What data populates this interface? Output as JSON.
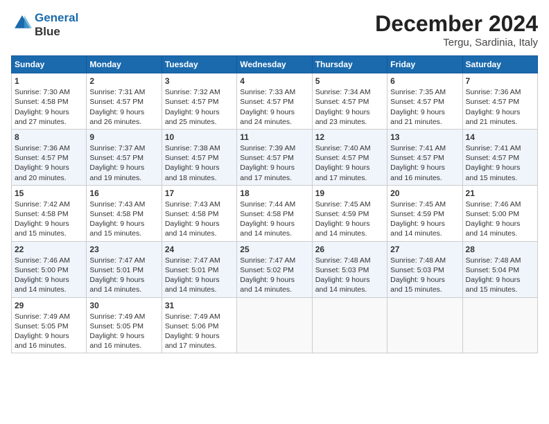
{
  "header": {
    "logo_line1": "General",
    "logo_line2": "Blue",
    "month": "December 2024",
    "location": "Tergu, Sardinia, Italy"
  },
  "days_of_week": [
    "Sunday",
    "Monday",
    "Tuesday",
    "Wednesday",
    "Thursday",
    "Friday",
    "Saturday"
  ],
  "weeks": [
    [
      {
        "day": "1",
        "lines": [
          "Sunrise: 7:30 AM",
          "Sunset: 4:58 PM",
          "Daylight: 9 hours",
          "and 27 minutes."
        ]
      },
      {
        "day": "2",
        "lines": [
          "Sunrise: 7:31 AM",
          "Sunset: 4:57 PM",
          "Daylight: 9 hours",
          "and 26 minutes."
        ]
      },
      {
        "day": "3",
        "lines": [
          "Sunrise: 7:32 AM",
          "Sunset: 4:57 PM",
          "Daylight: 9 hours",
          "and 25 minutes."
        ]
      },
      {
        "day": "4",
        "lines": [
          "Sunrise: 7:33 AM",
          "Sunset: 4:57 PM",
          "Daylight: 9 hours",
          "and 24 minutes."
        ]
      },
      {
        "day": "5",
        "lines": [
          "Sunrise: 7:34 AM",
          "Sunset: 4:57 PM",
          "Daylight: 9 hours",
          "and 23 minutes."
        ]
      },
      {
        "day": "6",
        "lines": [
          "Sunrise: 7:35 AM",
          "Sunset: 4:57 PM",
          "Daylight: 9 hours",
          "and 21 minutes."
        ]
      },
      {
        "day": "7",
        "lines": [
          "Sunrise: 7:36 AM",
          "Sunset: 4:57 PM",
          "Daylight: 9 hours",
          "and 21 minutes."
        ]
      }
    ],
    [
      {
        "day": "8",
        "lines": [
          "Sunrise: 7:36 AM",
          "Sunset: 4:57 PM",
          "Daylight: 9 hours",
          "and 20 minutes."
        ]
      },
      {
        "day": "9",
        "lines": [
          "Sunrise: 7:37 AM",
          "Sunset: 4:57 PM",
          "Daylight: 9 hours",
          "and 19 minutes."
        ]
      },
      {
        "day": "10",
        "lines": [
          "Sunrise: 7:38 AM",
          "Sunset: 4:57 PM",
          "Daylight: 9 hours",
          "and 18 minutes."
        ]
      },
      {
        "day": "11",
        "lines": [
          "Sunrise: 7:39 AM",
          "Sunset: 4:57 PM",
          "Daylight: 9 hours",
          "and 17 minutes."
        ]
      },
      {
        "day": "12",
        "lines": [
          "Sunrise: 7:40 AM",
          "Sunset: 4:57 PM",
          "Daylight: 9 hours",
          "and 17 minutes."
        ]
      },
      {
        "day": "13",
        "lines": [
          "Sunrise: 7:41 AM",
          "Sunset: 4:57 PM",
          "Daylight: 9 hours",
          "and 16 minutes."
        ]
      },
      {
        "day": "14",
        "lines": [
          "Sunrise: 7:41 AM",
          "Sunset: 4:57 PM",
          "Daylight: 9 hours",
          "and 15 minutes."
        ]
      }
    ],
    [
      {
        "day": "15",
        "lines": [
          "Sunrise: 7:42 AM",
          "Sunset: 4:58 PM",
          "Daylight: 9 hours",
          "and 15 minutes."
        ]
      },
      {
        "day": "16",
        "lines": [
          "Sunrise: 7:43 AM",
          "Sunset: 4:58 PM",
          "Daylight: 9 hours",
          "and 15 minutes."
        ]
      },
      {
        "day": "17",
        "lines": [
          "Sunrise: 7:43 AM",
          "Sunset: 4:58 PM",
          "Daylight: 9 hours",
          "and 14 minutes."
        ]
      },
      {
        "day": "18",
        "lines": [
          "Sunrise: 7:44 AM",
          "Sunset: 4:58 PM",
          "Daylight: 9 hours",
          "and 14 minutes."
        ]
      },
      {
        "day": "19",
        "lines": [
          "Sunrise: 7:45 AM",
          "Sunset: 4:59 PM",
          "Daylight: 9 hours",
          "and 14 minutes."
        ]
      },
      {
        "day": "20",
        "lines": [
          "Sunrise: 7:45 AM",
          "Sunset: 4:59 PM",
          "Daylight: 9 hours",
          "and 14 minutes."
        ]
      },
      {
        "day": "21",
        "lines": [
          "Sunrise: 7:46 AM",
          "Sunset: 5:00 PM",
          "Daylight: 9 hours",
          "and 14 minutes."
        ]
      }
    ],
    [
      {
        "day": "22",
        "lines": [
          "Sunrise: 7:46 AM",
          "Sunset: 5:00 PM",
          "Daylight: 9 hours",
          "and 14 minutes."
        ]
      },
      {
        "day": "23",
        "lines": [
          "Sunrise: 7:47 AM",
          "Sunset: 5:01 PM",
          "Daylight: 9 hours",
          "and 14 minutes."
        ]
      },
      {
        "day": "24",
        "lines": [
          "Sunrise: 7:47 AM",
          "Sunset: 5:01 PM",
          "Daylight: 9 hours",
          "and 14 minutes."
        ]
      },
      {
        "day": "25",
        "lines": [
          "Sunrise: 7:47 AM",
          "Sunset: 5:02 PM",
          "Daylight: 9 hours",
          "and 14 minutes."
        ]
      },
      {
        "day": "26",
        "lines": [
          "Sunrise: 7:48 AM",
          "Sunset: 5:03 PM",
          "Daylight: 9 hours",
          "and 14 minutes."
        ]
      },
      {
        "day": "27",
        "lines": [
          "Sunrise: 7:48 AM",
          "Sunset: 5:03 PM",
          "Daylight: 9 hours",
          "and 15 minutes."
        ]
      },
      {
        "day": "28",
        "lines": [
          "Sunrise: 7:48 AM",
          "Sunset: 5:04 PM",
          "Daylight: 9 hours",
          "and 15 minutes."
        ]
      }
    ],
    [
      {
        "day": "29",
        "lines": [
          "Sunrise: 7:49 AM",
          "Sunset: 5:05 PM",
          "Daylight: 9 hours",
          "and 16 minutes."
        ]
      },
      {
        "day": "30",
        "lines": [
          "Sunrise: 7:49 AM",
          "Sunset: 5:05 PM",
          "Daylight: 9 hours",
          "and 16 minutes."
        ]
      },
      {
        "day": "31",
        "lines": [
          "Sunrise: 7:49 AM",
          "Sunset: 5:06 PM",
          "Daylight: 9 hours",
          "and 17 minutes."
        ]
      },
      null,
      null,
      null,
      null
    ]
  ]
}
